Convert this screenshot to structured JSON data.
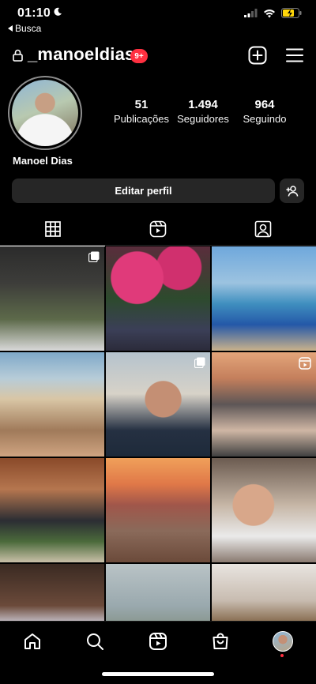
{
  "status_bar": {
    "time": "01:10",
    "back_label": "Busca"
  },
  "header": {
    "username": "_manoeldias",
    "notification_badge": "9+"
  },
  "profile": {
    "display_name": "Manoel Dias",
    "stats": [
      {
        "value": "51",
        "label": "Publicações"
      },
      {
        "value": "1.494",
        "label": "Seguidores"
      },
      {
        "value": "964",
        "label": "Seguindo"
      }
    ],
    "edit_profile_label": "Editar perfil"
  },
  "tabs": [
    {
      "icon": "grid-icon",
      "active": true
    },
    {
      "icon": "reels-icon",
      "active": false
    },
    {
      "icon": "tagged-icon",
      "active": false
    }
  ],
  "posts": [
    {
      "overlay": "carousel-icon"
    },
    {
      "overlay": ""
    },
    {
      "overlay": ""
    },
    {
      "overlay": ""
    },
    {
      "overlay": "carousel-icon"
    },
    {
      "overlay": "reel-icon"
    },
    {
      "overlay": ""
    },
    {
      "overlay": ""
    },
    {
      "overlay": ""
    },
    {
      "overlay": ""
    },
    {
      "overlay": ""
    },
    {
      "overlay": ""
    }
  ],
  "bottom_nav": [
    "home-icon",
    "search-icon",
    "reels-icon",
    "shop-icon",
    "profile-avatar"
  ],
  "colors": {
    "background": "#000000",
    "badge": "#ff3040",
    "button": "#262626",
    "divider": "#262626"
  }
}
